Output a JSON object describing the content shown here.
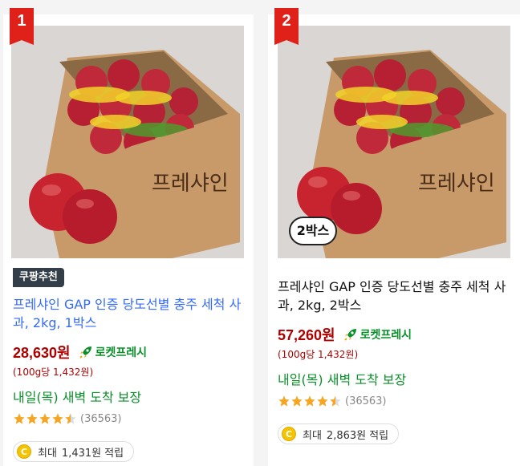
{
  "products": [
    {
      "rank": "1",
      "recommend_badge": {
        "brand": "쿠팡",
        "accent": "추천"
      },
      "title": "프레샤인 GAP 인증 당도선별 충주 세척 사과, 2kg, 1박스",
      "price": "28,630원",
      "delivery_badge": "로켓프레시",
      "unit_price": "(100g당 1,432원)",
      "arrival": "내일(목) 새벽 도착 보장",
      "rating": 4.5,
      "review_count": "(36563)",
      "reward": {
        "label": "최대",
        "amount": "1,431원",
        "suffix": "적립"
      }
    },
    {
      "rank": "2",
      "quantity_badge": "2박스",
      "title": "프레샤인 GAP 인증 당도선별 충주 세척 사과, 2kg, 2박스",
      "price": "57,260원",
      "delivery_badge": "로켓프레시",
      "unit_price": "(100g당 1,432원)",
      "arrival": "내일(목) 새벽 도착 보장",
      "rating": 4.5,
      "review_count": "(36563)",
      "reward": {
        "label": "최대",
        "amount": "2,863원",
        "suffix": "적립"
      }
    }
  ],
  "colors": {
    "rank_red": "#e0211a",
    "title_link_blue": "#346aff",
    "price_red": "#ae0000",
    "rocket_green": "#0a8f2a",
    "star_orange": "#f5a623",
    "coin_yellow": "#f5c400"
  }
}
